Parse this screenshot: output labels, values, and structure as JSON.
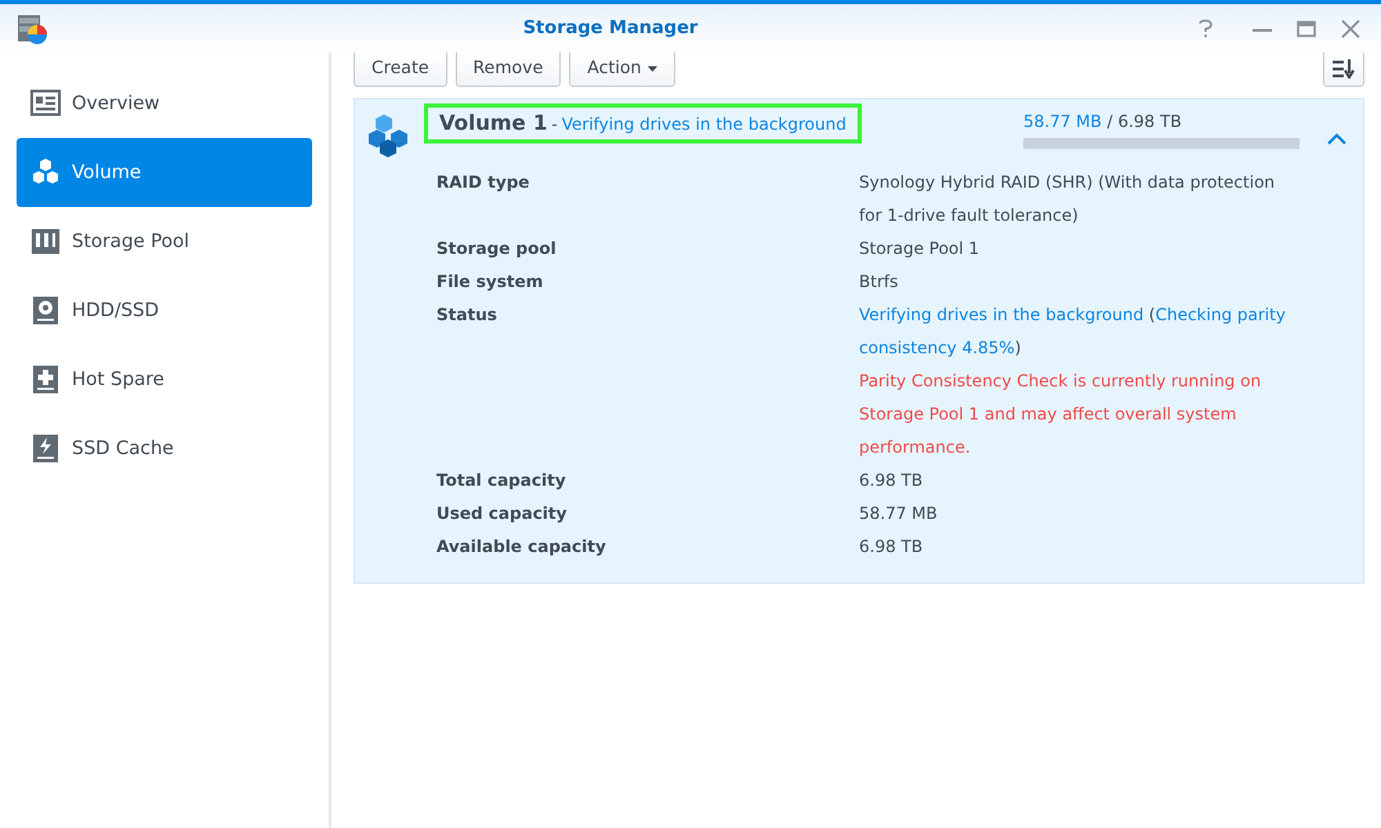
{
  "window": {
    "title": "Storage Manager"
  },
  "sidebar": {
    "items": [
      {
        "label": "Overview",
        "kind": "overview",
        "selected": false
      },
      {
        "label": "Volume",
        "kind": "volume",
        "selected": true
      },
      {
        "label": "Storage Pool",
        "kind": "pool",
        "selected": false
      },
      {
        "label": "HDD/SSD",
        "kind": "disk",
        "selected": false
      },
      {
        "label": "Hot Spare",
        "kind": "spare",
        "selected": false
      },
      {
        "label": "SSD Cache",
        "kind": "cache",
        "selected": false
      }
    ]
  },
  "toolbar": {
    "buttons": [
      {
        "label": "Create",
        "dropdown": false
      },
      {
        "label": "Remove",
        "dropdown": false
      },
      {
        "label": "Action",
        "dropdown": true
      }
    ]
  },
  "volume": {
    "name": "Volume 1",
    "separator": "-",
    "status": "Verifying drives in the background",
    "highlighted": true,
    "used": "58.77 MB",
    "slash": "/",
    "total": "6.98 TB",
    "level": 0,
    "expanded": true,
    "details": [
      {
        "kind": "text",
        "label": "RAID type",
        "value": "Synology Hybrid RAID (SHR) (With data protection for 1-drive fault tolerance)"
      },
      {
        "kind": "text",
        "label": "Storage pool",
        "value": "Storage Pool 1"
      },
      {
        "kind": "text",
        "label": "File system",
        "value": "Btrfs"
      },
      {
        "kind": "status",
        "label": "Status",
        "parts": [
          {
            "text": "Verifying drives in the background",
            "kind": "link"
          },
          {
            "text": " (",
            "kind": "plain"
          },
          {
            "text": "Checking parity consistency 4.85%",
            "kind": "link"
          },
          {
            "text": ")",
            "kind": "plain"
          }
        ],
        "warning": "Parity Consistency Check is currently running on Storage Pool 1 and may affect overall system performance."
      },
      {
        "kind": "text",
        "label": "Total capacity",
        "value": "6.98 TB"
      },
      {
        "kind": "text",
        "label": "Used capacity",
        "value": "58.77 MB"
      },
      {
        "kind": "text",
        "label": "Available capacity",
        "value": "6.98 TB"
      }
    ]
  }
}
